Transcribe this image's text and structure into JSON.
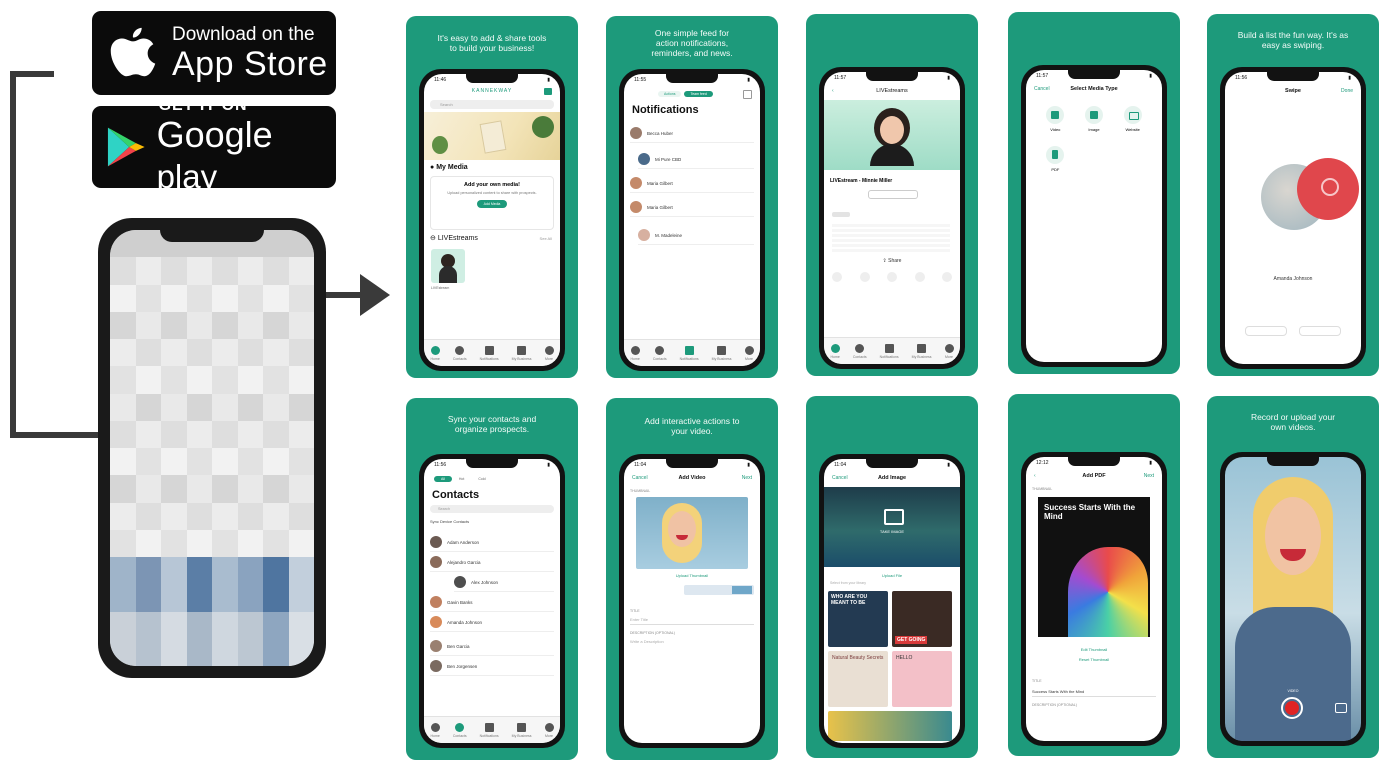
{
  "badges": {
    "apple": {
      "line1": "Download on the",
      "line2": "App Store"
    },
    "google": {
      "line1": "GET IT ON",
      "line2a": "Google",
      "line2b": " play"
    }
  },
  "cards": [
    {
      "caption": "It's easy to add & share tools to build your business!",
      "screen": {
        "time": "11:46",
        "brand": "KANNEKWAY",
        "search": "Search",
        "section1": "My Media",
        "add_title": "Add your own media!",
        "add_sub": "Upload personalized content to share with prospects.",
        "add_btn": "Add Media",
        "section2": "LIVEstreams",
        "see_all": "See All",
        "item_label": "LIVEstream",
        "tabs": [
          "Home",
          "Contacts",
          "Notifications",
          "My Business",
          "More"
        ]
      }
    },
    {
      "caption": "One simple feed for action notifications, reminders, and news.",
      "screen": {
        "time": "11:55",
        "seg": [
          "Actions",
          "Team feed"
        ],
        "title": "Notifications",
        "rows": [
          "Becca Huber",
          "Mi Pure CBD",
          "Maria Gilbert",
          "Maria Gilbert",
          "M. Madeleine"
        ],
        "tabs": [
          "Home",
          "Contacts",
          "Notifications",
          "My Business",
          "More"
        ]
      }
    },
    {
      "caption": "",
      "screen": {
        "time": "11:57",
        "nav": "LIVEstreams",
        "name": "LIVEstream - Minnie Miller",
        "share": "Share",
        "tabs": [
          "Home",
          "Contacts",
          "Notifications",
          "My Business",
          "More"
        ]
      }
    },
    {
      "caption": "",
      "screen": {
        "time": "11:57",
        "cancel": "Cancel",
        "title": "Select Media Type",
        "types": [
          "Video",
          "Image",
          "Website",
          "PDF"
        ]
      }
    },
    {
      "caption": "Build a list the fun way. It's as easy as swiping.",
      "screen": {
        "time": "11:56",
        "title": "Swipe",
        "done": "Done",
        "person": "Amanda Johnson"
      }
    },
    {
      "caption": "Sync your contacts and organize prospects.",
      "screen": {
        "time": "11:56",
        "seg": [
          "All",
          "Hot",
          "Cold"
        ],
        "title": "Contacts",
        "search": "Search",
        "sync": "Sync Device Contacts",
        "rows": [
          "Adam Anderson",
          "Alejandro Garcia",
          "Alex Johnson",
          "Gavin Banks",
          "Amanda Johnson",
          "Ben Garcia",
          "Ben Jorgensen"
        ],
        "tabs": [
          "Home",
          "Contacts",
          "Notifications",
          "My Business",
          "More"
        ]
      }
    },
    {
      "caption": "Add interactive actions to your video.",
      "screen": {
        "time": "11:04",
        "cancel": "Cancel",
        "title": "Add Video",
        "next": "Next",
        "thumb_label": "THUMBNAIL",
        "upload": "Upload Thumbnail",
        "title_label": "TITLE",
        "title_ph": "Enter Title",
        "desc_label": "DESCRIPTION (OPTIONAL)",
        "desc_ph": "Write a Description"
      }
    },
    {
      "caption": "",
      "screen": {
        "time": "11:04",
        "cancel": "Cancel",
        "title": "Add Image",
        "take": "TAKE IMAGE",
        "upload": "Upload File",
        "recent": "Select from your library",
        "tile1": "WHO ARE YOU MEANT TO BE",
        "tile2": "GET GOING",
        "tile3": "Natural Beauty Secrets",
        "tile4": "HELLO"
      }
    },
    {
      "caption": "",
      "screen": {
        "time": "12:12",
        "title": "Add PDF",
        "next": "Next",
        "thumb_label": "THUMBNAIL",
        "book_title": "Success Starts With the Mind",
        "change": "Edit Thumbnail",
        "reset": "Reset Thumbnail",
        "title_label": "TITLE",
        "title_val": "Success Starts With the Mind",
        "desc_label": "DESCRIPTION (OPTIONAL)"
      }
    },
    {
      "caption": "Record or upload your own videos.",
      "screen": {
        "time": "",
        "video": "VIDEO"
      }
    }
  ],
  "colors": {
    "brand_green": "#1d9a7b",
    "badge_black": "#0b0b0b"
  }
}
